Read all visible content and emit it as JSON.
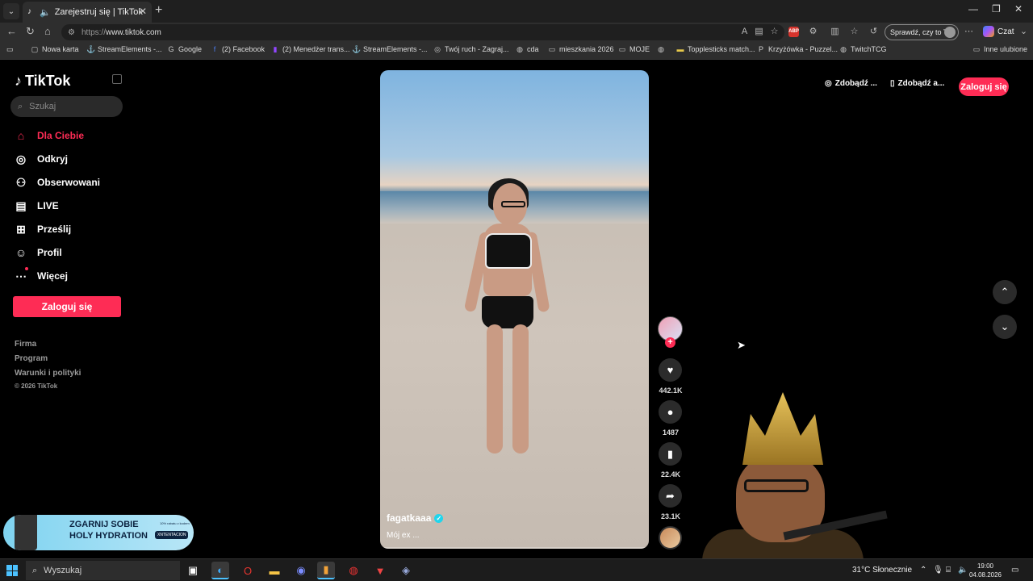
{
  "browser": {
    "tab_title": "Zarejestruj się | TikTok",
    "url_protocol": "https://",
    "url_host": "www.tiktok.com",
    "profile_prompt": "Sprawdź, czy to Ty",
    "copilot_label": "Czat",
    "abp_label": "ABP",
    "bookmarks": [
      {
        "label": "Nowa karta",
        "icon": "page-icon"
      },
      {
        "label": "StreamElements -...",
        "icon": "anchor-icon"
      },
      {
        "label": "Google",
        "icon": "google-icon"
      },
      {
        "label": "(2) Facebook",
        "icon": "facebook-icon"
      },
      {
        "label": "(2) Menedżer trans...",
        "icon": "twitch-icon"
      },
      {
        "label": "StreamElements -...",
        "icon": "anchor-icon"
      },
      {
        "label": "Twój ruch - Zagraj...",
        "icon": "game-icon"
      },
      {
        "label": "cda",
        "icon": "globe-icon"
      },
      {
        "label": "mieszkania 2026",
        "icon": "folder-icon"
      },
      {
        "label": "MOJE",
        "icon": "folder-icon"
      },
      {
        "label": "",
        "icon": "globe-icon"
      },
      {
        "label": "Topplesticks match...",
        "icon": "folder-icon"
      },
      {
        "label": "Krzyżówka - Puzzel...",
        "icon": "puzzle-icon"
      },
      {
        "label": "TwitchTCG",
        "icon": "globe-icon"
      }
    ],
    "other_favorites": "Inne ulubione"
  },
  "sidebar": {
    "logo": "TikTok",
    "search_placeholder": "Szukaj",
    "nav": [
      {
        "label": "Dla Ciebie",
        "icon": "home-icon",
        "active": true
      },
      {
        "label": "Odkryj",
        "icon": "compass-icon"
      },
      {
        "label": "Obserwowani",
        "icon": "following-icon"
      },
      {
        "label": "LIVE",
        "icon": "live-icon"
      },
      {
        "label": "Prześlij",
        "icon": "upload-icon"
      },
      {
        "label": "Profil",
        "icon": "profile-icon"
      },
      {
        "label": "Więcej",
        "icon": "more-icon"
      }
    ],
    "login_button": "Zaloguj się",
    "footer_links": [
      "Firma",
      "Program",
      "Warunki i polityki"
    ],
    "copyright": "© 2026 TikTok"
  },
  "header_right": {
    "get_coins": "Zdobądź ...",
    "get_app": "Zdobądź a...",
    "login": "Zaloguj się"
  },
  "video": {
    "username": "fagatkaaa",
    "description": "Mój ex ...",
    "likes": "442.1K",
    "comments": "1487",
    "saves": "22.4K",
    "shares": "23.1K"
  },
  "ad_overlay": {
    "line1": "ZGARNIJ SOBIE",
    "line2": "HOLY HYDRATION",
    "badge": "XNTENTACION",
    "small": "10% rabatu z kodem"
  },
  "taskbar": {
    "search_placeholder": "Wyszukaj",
    "weather": "31°C  Słonecznie",
    "time": "19:00",
    "date": "04.08.2026"
  }
}
